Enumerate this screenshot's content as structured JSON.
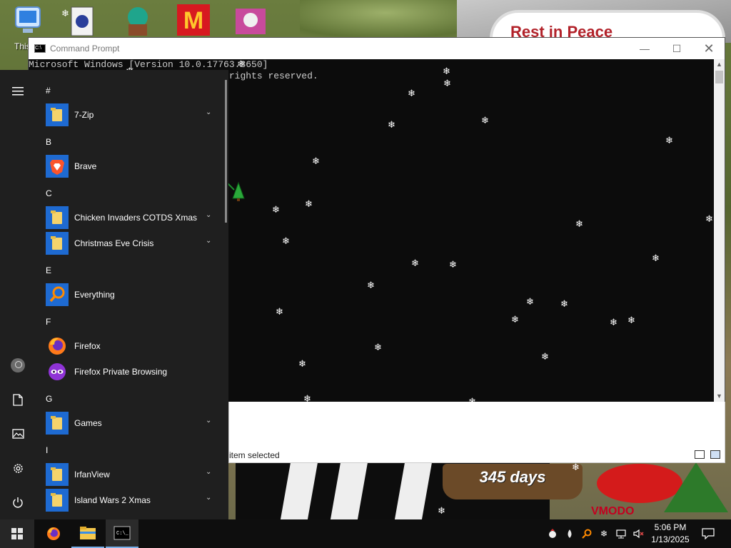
{
  "desktop": {
    "icon_label_partial": "This",
    "sign_text": "Rest in Peace",
    "days_text": "345 days",
    "logo_text": "VMODO"
  },
  "explorer": {
    "status_text": "item selected"
  },
  "cmd": {
    "title": "Command Prompt",
    "lines": [
      "Microsoft Windows [Version 10.0.17763.3650]",
      "(c) 2018 Microsoft Corporation. All rights reserved."
    ],
    "minimize_icon": "minimize-icon",
    "maximize_icon": "maximize-icon",
    "close_icon": "close-icon"
  },
  "start_menu": {
    "sections": [
      {
        "letter": "#",
        "apps": [
          {
            "name": "7-Zip",
            "icon": "folder-icon",
            "expandable": true
          }
        ]
      },
      {
        "letter": "B",
        "apps": [
          {
            "name": "Brave",
            "icon": "brave-icon",
            "expandable": false
          }
        ]
      },
      {
        "letter": "C",
        "apps": [
          {
            "name": "Chicken Invaders COTDS Xmas",
            "icon": "folder-icon",
            "expandable": true
          },
          {
            "name": "Christmas Eve Crisis",
            "icon": "folder-icon",
            "expandable": true
          }
        ]
      },
      {
        "letter": "E",
        "apps": [
          {
            "name": "Everything",
            "icon": "search-icon",
            "expandable": false
          }
        ]
      },
      {
        "letter": "F",
        "apps": [
          {
            "name": "Firefox",
            "icon": "firefox-icon",
            "expandable": false
          },
          {
            "name": "Firefox Private Browsing",
            "icon": "firefox-private-icon",
            "expandable": false
          }
        ]
      },
      {
        "letter": "G",
        "apps": [
          {
            "name": "Games",
            "icon": "folder-icon",
            "expandable": true
          }
        ]
      },
      {
        "letter": "I",
        "apps": [
          {
            "name": "IrfanView",
            "icon": "folder-icon",
            "expandable": true
          },
          {
            "name": "Island Wars 2 Xmas",
            "icon": "folder-icon",
            "expandable": true
          }
        ]
      }
    ],
    "rail": [
      "hamburger-icon",
      "user-avatar",
      "document-icon",
      "pictures-icon",
      "settings-icon",
      "power-icon"
    ]
  },
  "taskbar": {
    "pinned": [
      "windows-start-icon",
      "firefox-icon",
      "file-explorer-icon",
      "command-prompt-icon"
    ],
    "clock_time": "5:06 PM",
    "clock_date": "1/13/2025",
    "tray": [
      "chicken-tray-icon",
      "droplet-tray-icon",
      "search-tray-icon",
      "snowflake-tray-icon",
      "network-tray-icon",
      "volume-muted-icon",
      "notification-icon"
    ]
  },
  "colors": {
    "start_menu_bg": "#1f1f1f",
    "taskbar_bg": "#0e0e0e",
    "tile_blue": "#1e6ad1",
    "console_bg": "#0c0c0c",
    "console_text": "#cccccc"
  }
}
